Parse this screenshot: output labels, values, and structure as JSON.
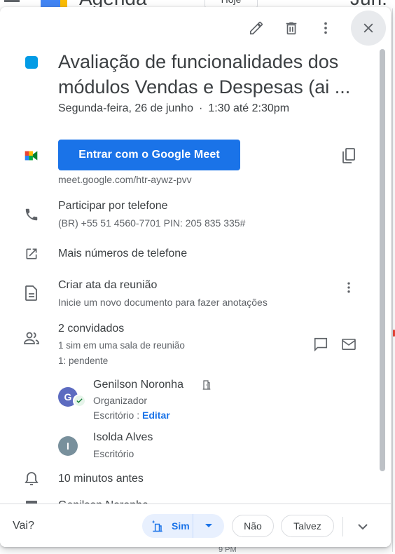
{
  "background": {
    "app_title": "Agenda",
    "today_button": "Hoje",
    "month_label": "Jun.",
    "hour_label": "9 PM"
  },
  "toolbar": {
    "edit": "pencil-icon",
    "delete": "trash-icon",
    "more": "more-vert-icon",
    "close": "close-icon"
  },
  "event": {
    "color": "#039be5",
    "title": "Avaliação de funcionalidades dos módulos Vendas e Despesas (ai ...",
    "date": "Segunda-feira, 26 de junho",
    "separator": "·",
    "time": "1:30 até 2:30pm"
  },
  "meet": {
    "join_label": "Entrar com o Google Meet",
    "link": "meet.google.com/htr-aywz-pvv"
  },
  "phone": {
    "title": "Participar por telefone",
    "details": "(BR) +55 51 4560-7701 PIN: 205 835 335#",
    "more_numbers": "Mais números de telefone"
  },
  "notes": {
    "title": "Criar ata da reunião",
    "subtitle": "Inicie um novo documento para fazer anotações"
  },
  "guests": {
    "count": "2 convidados",
    "summary_yes": "1 sim em uma sala de reunião",
    "summary_pending": "1: pendente",
    "list": [
      {
        "initial": "G",
        "name": "Genilson Noronha",
        "role": "Organizador",
        "location": "Escritório",
        "location_sep": " : ",
        "edit": "Editar",
        "avatar_color": "#5c6bc0"
      },
      {
        "initial": "I",
        "name": "Isolda Alves",
        "location": "Escritório",
        "avatar_color": "#78909c"
      }
    ]
  },
  "reminder": {
    "text": "10 minutos antes"
  },
  "calendar_owner_partial": "Genilson Noronha",
  "rsvp": {
    "question": "Vai?",
    "yes": "Sim",
    "no": "Não",
    "maybe": "Talvez"
  }
}
